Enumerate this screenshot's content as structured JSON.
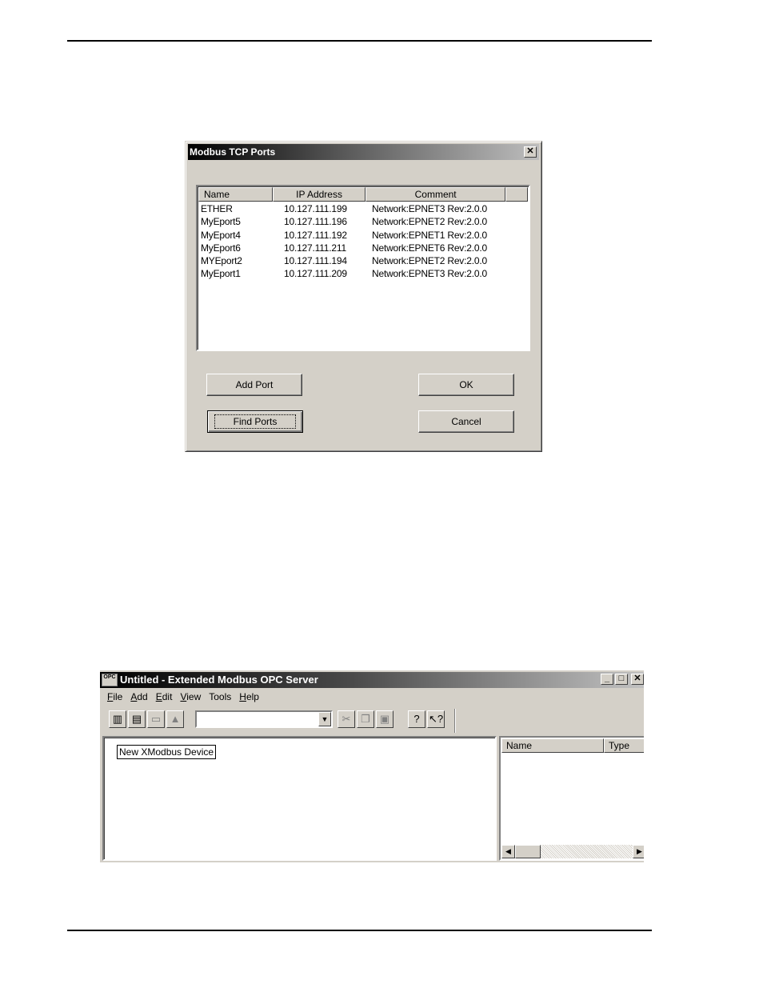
{
  "dialog": {
    "title": "Modbus TCP Ports",
    "close_glyph": "✕",
    "columns": [
      "Name",
      "IP Address",
      "Comment"
    ],
    "rows": [
      [
        "ETHER",
        "10.127.111.199",
        "Network:EPNET3 Rev:2.0.0"
      ],
      [
        "MyEport5",
        "10.127.111.196",
        "Network:EPNET2 Rev:2.0.0"
      ],
      [
        "MyEport4",
        "10.127.111.192",
        "Network:EPNET1 Rev:2.0.0"
      ],
      [
        "MyEport6",
        "10.127.111.211",
        "Network:EPNET6 Rev:2.0.0"
      ],
      [
        "MYEport2",
        "10.127.111.194",
        "Network:EPNET2 Rev:2.0.0"
      ],
      [
        "MyEport1",
        "10.127.111.209",
        "Network:EPNET3 Rev:2.0.0"
      ]
    ],
    "buttons": {
      "add_port": "Add Port",
      "ok": "OK",
      "find_ports": "Find Ports",
      "cancel": "Cancel"
    }
  },
  "app": {
    "title": "Untitled - Extended Modbus OPC Server",
    "icon_text": "OPC",
    "window_controls": {
      "minimize": "_",
      "maximize": "□",
      "close": "✕"
    },
    "menu": [
      {
        "key": "F",
        "rest": "ile"
      },
      {
        "key": "A",
        "rest": "dd"
      },
      {
        "key": "E",
        "rest": "dit"
      },
      {
        "key": "V",
        "rest": "iew"
      },
      {
        "key": "",
        "rest": "Tools"
      },
      {
        "key": "H",
        "rest": "elp"
      }
    ],
    "tree_item": "New XModbus Device",
    "list_columns": [
      "Name",
      "Type"
    ],
    "combo_value": ""
  }
}
